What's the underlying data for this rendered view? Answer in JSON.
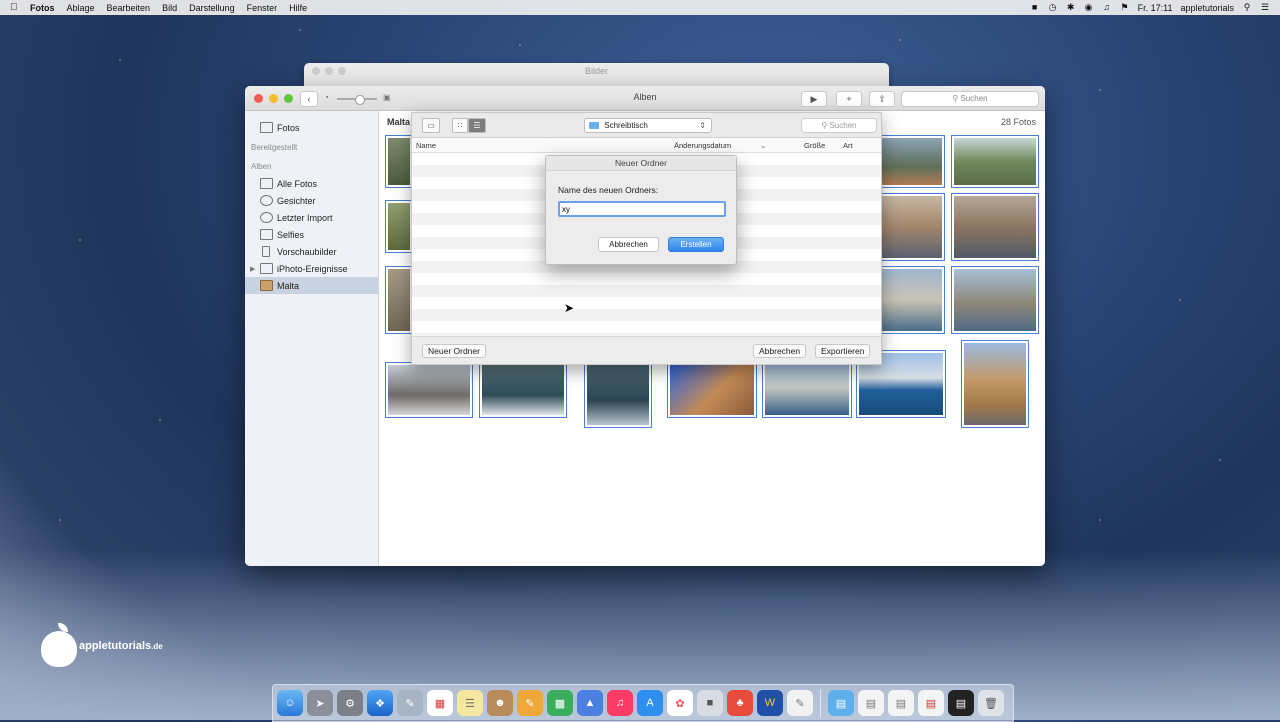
{
  "menubar": {
    "app_name": "Fotos",
    "menus": [
      "Ablage",
      "Bearbeiten",
      "Bild",
      "Darstellung",
      "Fenster",
      "Hilfe"
    ],
    "clock": "Fr. 17:11",
    "user": "appletutorials"
  },
  "background_window": {
    "title": "Bilder"
  },
  "window": {
    "title": "Alben",
    "search_placeholder": "Suchen",
    "sidebar": {
      "top_item": "Fotos",
      "section_shared": "Bereitgestellt",
      "section_albums": "Alben",
      "items": [
        {
          "label": "Alle Fotos",
          "icon": "photos-icon"
        },
        {
          "label": "Gesichter",
          "icon": "person-icon"
        },
        {
          "label": "Letzter Import",
          "icon": "clock-icon"
        },
        {
          "label": "Selfies",
          "icon": "camera-icon"
        },
        {
          "label": "Vorschaubilder",
          "icon": "phone-icon"
        },
        {
          "label": "iPhoto-Ereignisse",
          "icon": "folder-icon"
        },
        {
          "label": "Malta",
          "icon": "album-icon"
        }
      ]
    },
    "main": {
      "album_title": "Malta",
      "photo_count": "28 Fotos"
    }
  },
  "export_sheet": {
    "location": "Schreibtisch",
    "search_placeholder": "Suchen",
    "columns": {
      "name": "Name",
      "date": "Änderungsdatum",
      "size": "Größe",
      "kind": "Art"
    },
    "new_folder_button": "Neuer Ordner",
    "cancel_button": "Abbrechen",
    "export_button": "Exportieren"
  },
  "new_folder_dialog": {
    "title": "Neuer Ordner",
    "label": "Name des neuen Ordners:",
    "value": "xy",
    "cancel_button": "Abbrechen",
    "create_button": "Erstellen"
  },
  "watermark": {
    "brand": "appletutorials",
    "tld": ".de"
  },
  "colors": {
    "accent": "#2f86ec",
    "selection": "#c9d2e0",
    "photo_border": "#4a7fd6"
  }
}
